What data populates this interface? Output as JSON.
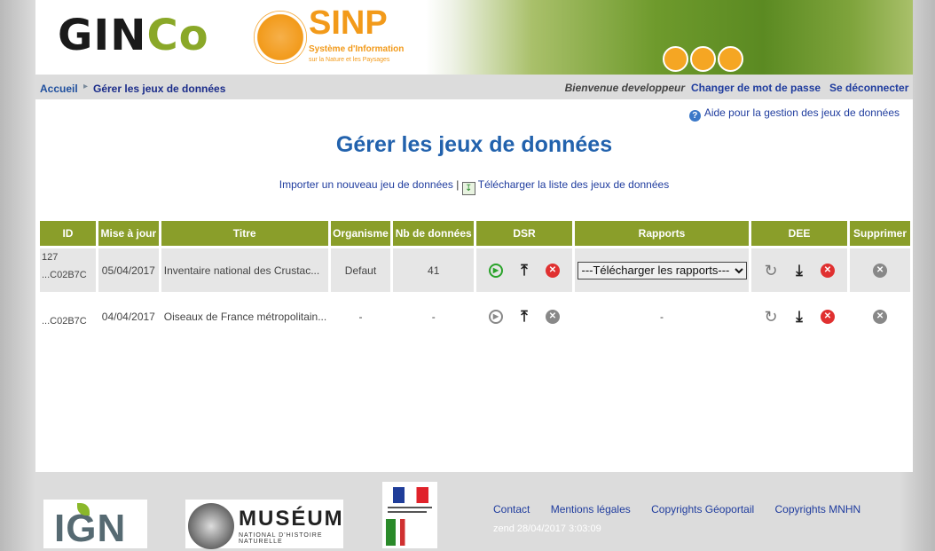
{
  "header": {
    "logo_text_1": "GIN",
    "logo_text_2": "Co",
    "sinp_title": "SINP",
    "sinp_subtitle": "Système d'Information",
    "sinp_subtitle2": "sur la Nature et les Paysages"
  },
  "nav": {
    "home": "Accueil",
    "current": "Gérer les jeux de données",
    "welcome": "Bienvenue developpeur",
    "change_password": "Changer de mot de passe",
    "logout": "Se déconnecter"
  },
  "main": {
    "help_link": "Aide pour la gestion des jeux de données",
    "title": "Gérer les jeux de données",
    "import_link": "Importer un nouveau jeu de données",
    "separator": " | ",
    "download_list_link": "Télécharger la liste des jeux de données"
  },
  "table": {
    "headers": [
      "ID",
      "Mise à jour",
      "Titre",
      "Organisme",
      "Nb de données",
      "DSR",
      "Rapports",
      "DEE",
      "Supprimer"
    ],
    "rows": [
      {
        "id_line1": "127",
        "id_line2": "...C02B7C",
        "updated": "05/04/2017",
        "title": "Inventaire national des Crustac...",
        "organisme": "Defaut",
        "count": "41",
        "reports_select": "---Télécharger les rapports---"
      },
      {
        "id_line1": "",
        "id_line2": "...C02B7C",
        "updated": "04/04/2017",
        "title": "Oiseaux de France métropolitain...",
        "organisme": "-",
        "count": "-",
        "reports": "-"
      }
    ]
  },
  "footer": {
    "ign": "IGN",
    "museum": "MUSÉUM",
    "museum_sub": "NATIONAL D'HISTOIRE NATURELLE",
    "links": [
      "Contact",
      "Mentions légales",
      "Copyrights Géoportail",
      "Copyrights MNHN"
    ],
    "version": "zend 28/04/2017 3:03:09"
  },
  "icons": {
    "help": "help-icon",
    "play": "play-icon",
    "upload": "upload-icon",
    "download": "download-icon",
    "delete": "delete-icon",
    "refresh": "refresh-icon"
  },
  "colors": {
    "table_header": "#8a9e2a",
    "title": "#2262ad",
    "link": "#1f3c9e"
  }
}
